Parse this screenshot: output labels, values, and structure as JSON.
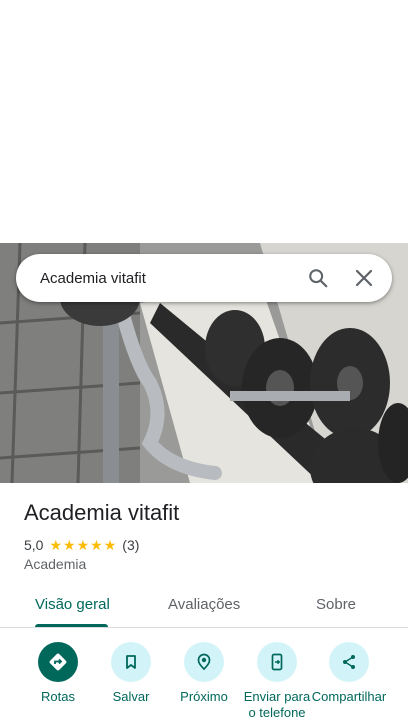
{
  "search": {
    "query": "Academia vitafit",
    "search_icon": "search-icon",
    "close_icon": "close-icon"
  },
  "hero": {
    "image_subject": "gym dumbbell rack photo"
  },
  "place": {
    "name": "Academia vitafit",
    "rating": "5,0",
    "rating_value": 5,
    "stars": "★★★★★",
    "review_count": "(3)",
    "category": "Academia"
  },
  "tabs": [
    {
      "label": "Visão geral",
      "active": true
    },
    {
      "label": "Avaliações",
      "active": false
    },
    {
      "label": "Sobre",
      "active": false
    }
  ],
  "actions": [
    {
      "label": "Rotas",
      "icon": "directions-icon",
      "primary": true
    },
    {
      "label": "Salvar",
      "icon": "bookmark-icon",
      "primary": false
    },
    {
      "label": "Próximo",
      "icon": "nearby-icon",
      "primary": false
    },
    {
      "label": "Enviar para o telefone",
      "icon": "send-to-phone-icon",
      "primary": false
    },
    {
      "label": "Compartilhar",
      "icon": "share-icon",
      "primary": false
    }
  ],
  "colors": {
    "accent": "#00685b",
    "action_bg": "#d2f4f8",
    "star": "#fbbc04",
    "divider": "#dadce0"
  }
}
